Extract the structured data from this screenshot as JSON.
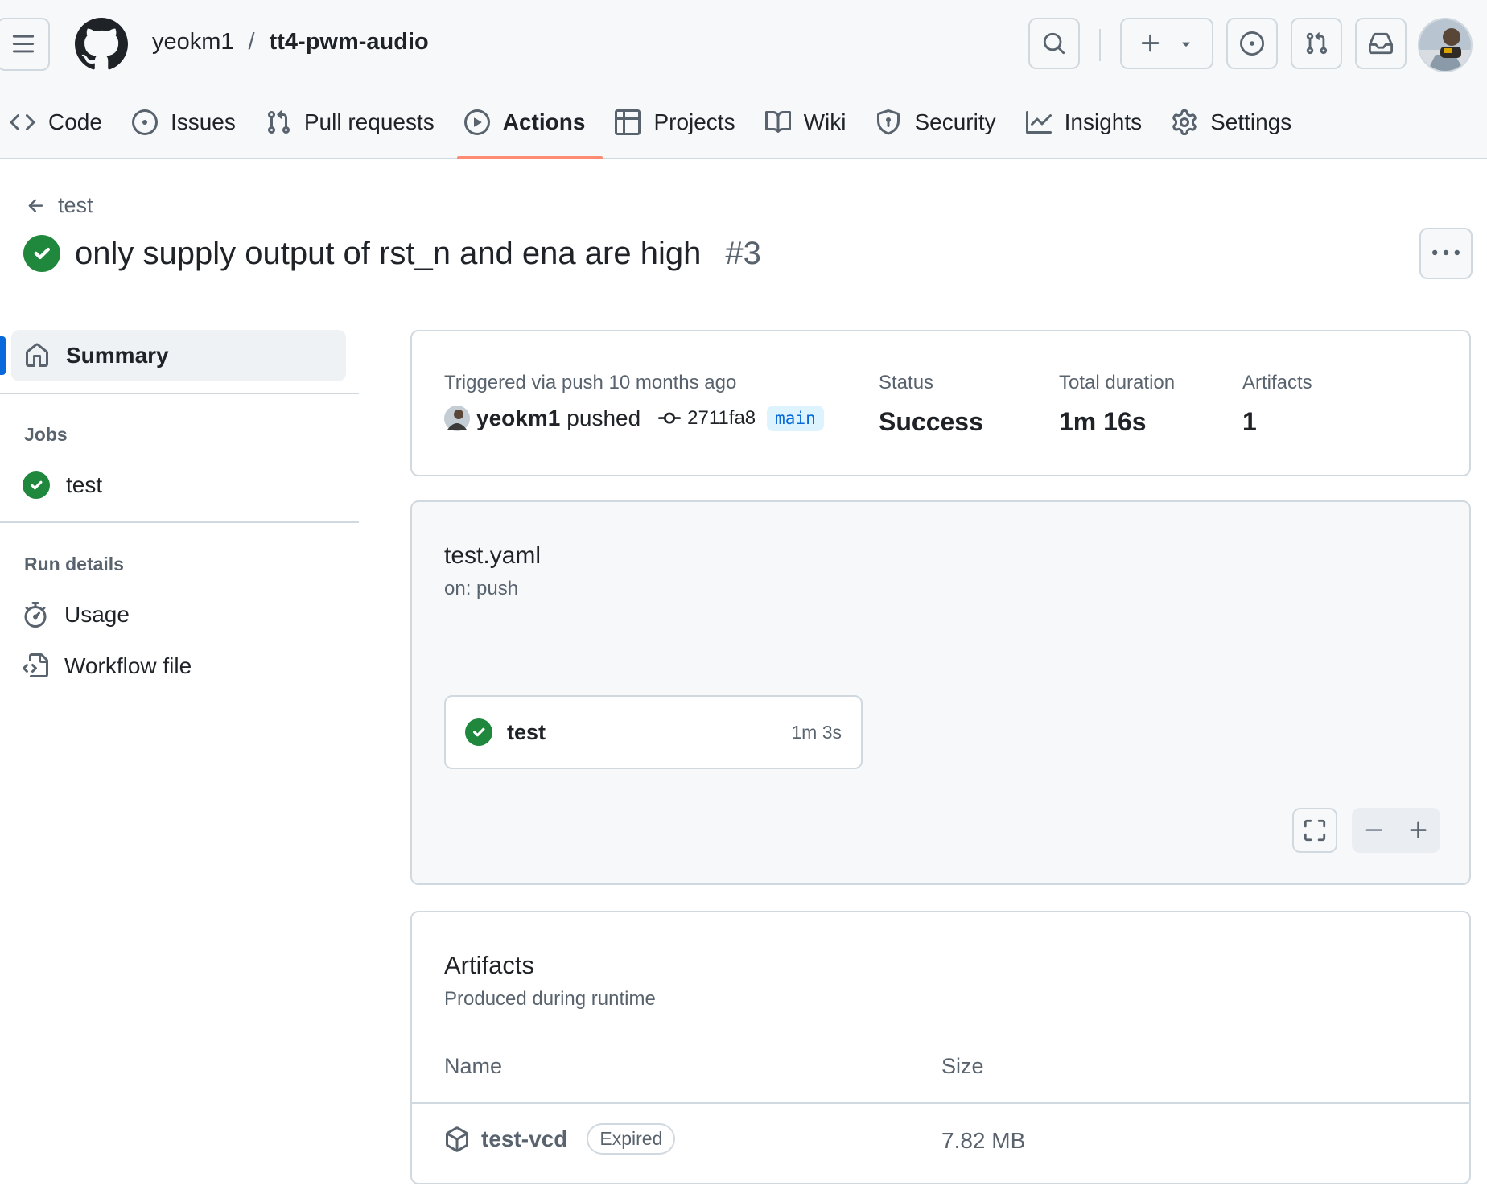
{
  "header": {
    "owner": "yeokm1",
    "separator": "/",
    "repo": "tt4-pwm-audio"
  },
  "tabs": [
    {
      "label": "Code",
      "icon": "code-icon"
    },
    {
      "label": "Issues",
      "icon": "issue-icon"
    },
    {
      "label": "Pull requests",
      "icon": "pull-request-icon"
    },
    {
      "label": "Actions",
      "icon": "play-icon",
      "active": true
    },
    {
      "label": "Projects",
      "icon": "table-icon"
    },
    {
      "label": "Wiki",
      "icon": "book-icon"
    },
    {
      "label": "Security",
      "icon": "shield-icon"
    },
    {
      "label": "Insights",
      "icon": "graph-icon"
    },
    {
      "label": "Settings",
      "icon": "gear-icon"
    }
  ],
  "page": {
    "back_label": "test",
    "title": "only supply output of rst_n and ena are high",
    "run_number": "#3"
  },
  "sidebar": {
    "summary": "Summary",
    "jobs_heading": "Jobs",
    "jobs": [
      {
        "label": "test",
        "status": "success"
      }
    ],
    "run_details_heading": "Run details",
    "run_details": [
      {
        "label": "Usage",
        "icon": "stopwatch-icon"
      },
      {
        "label": "Workflow file",
        "icon": "file-code-icon"
      }
    ]
  },
  "summary": {
    "triggered": "Triggered via push 10 months ago",
    "user": "yeokm1",
    "action": "pushed",
    "commit": "2711fa8",
    "branch": "main",
    "status_label": "Status",
    "status_value": "Success",
    "duration_label": "Total duration",
    "duration_value": "1m 16s",
    "artifacts_label": "Artifacts",
    "artifacts_value": "1"
  },
  "workflow": {
    "file": "test.yaml",
    "trigger": "on: push",
    "job": {
      "name": "test",
      "duration": "1m 3s",
      "status": "success"
    }
  },
  "artifacts": {
    "title": "Artifacts",
    "subtitle": "Produced during runtime",
    "col_name": "Name",
    "col_size": "Size",
    "rows": [
      {
        "name": "test-vcd",
        "badge": "Expired",
        "size": "7.82 MB"
      }
    ]
  },
  "colors": {
    "accent_tab": "#fd8c73",
    "success": "#1f883d",
    "link": "#0969da"
  }
}
